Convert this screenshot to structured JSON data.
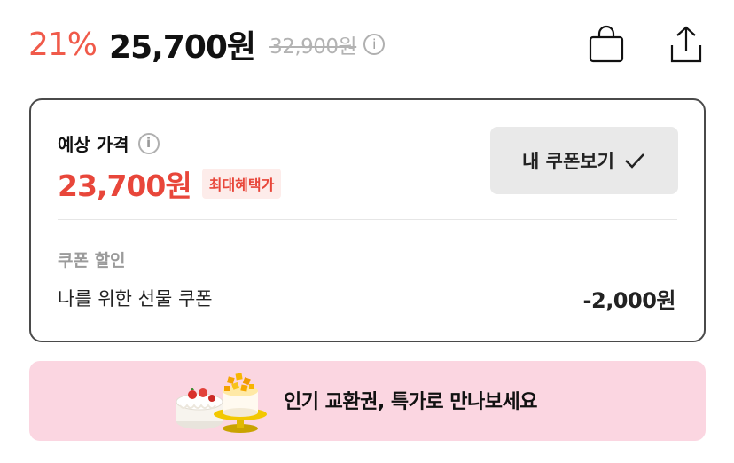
{
  "price": {
    "discount_rate": "21%",
    "sale_price": "25,700원",
    "original_price": "32,900원",
    "info_icon": "i"
  },
  "header_icons": {
    "bag": "shopping-bag-icon",
    "share": "share-icon"
  },
  "estimate": {
    "label": "예상 가격",
    "info_icon": "i",
    "price": "23,700원",
    "badge": "최대혜택가",
    "coupon_button": "내 쿠폰보기"
  },
  "coupon": {
    "section_title": "쿠폰 할인",
    "name": "나를 위한 선물 쿠폰",
    "amount": "-2,000원"
  },
  "banner": {
    "text": "인기 교환권, 특가로 만나보세요"
  },
  "colors": {
    "discount": "#f05a4a",
    "estimate_price": "#e8463a",
    "badge_bg": "#fdecea",
    "banner_bg": "#fbd6e1",
    "coupon_button_bg": "#e9e9e9"
  }
}
